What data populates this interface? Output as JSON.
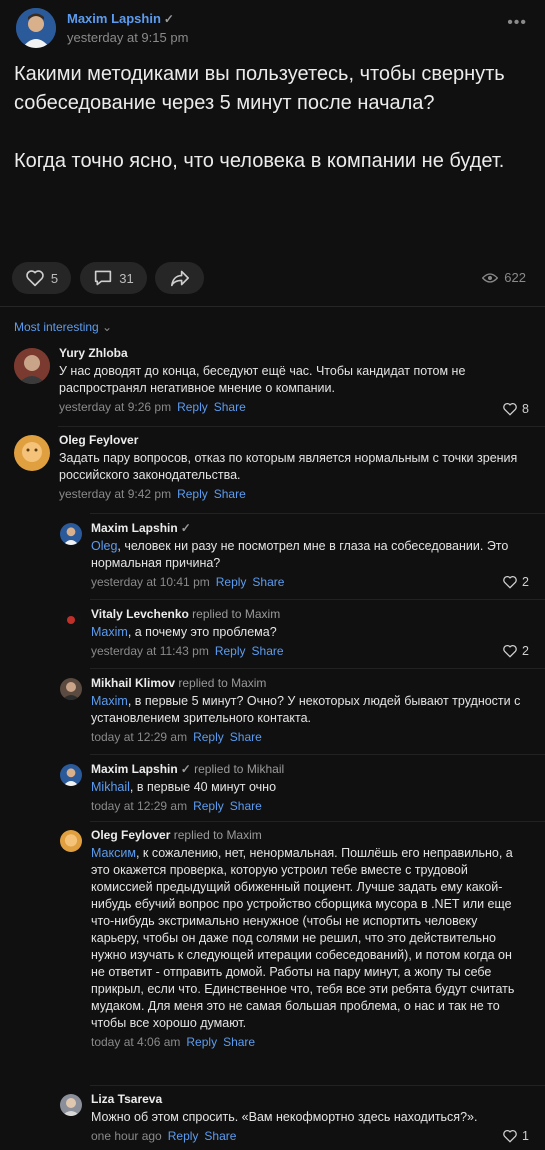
{
  "post": {
    "author": "Maxim Lapshin",
    "verified": "✓",
    "time": "yesterday at 9:15 pm",
    "more": "•••",
    "body_p1": "Какими методиками вы пользуетесь, чтобы свернуть собеседование через 5 минут после начала?",
    "body_p2": "Когда точно ясно, что человека в компании не будет.",
    "likes": "5",
    "comments": "31",
    "views": "622"
  },
  "sort_label": "Most interesting",
  "links": {
    "reply": "Reply",
    "share": "Share",
    "replied_to": "replied to"
  },
  "comments": [
    {
      "author": "Yury Zhloba",
      "text": "У нас доводят до конца, беседуют ещё час. Чтобы кандидат потом не распространял негативное мнение о компании.",
      "time": "yesterday at 9:26 pm",
      "likes": "8"
    },
    {
      "author": "Oleg Feylover",
      "text": "Задать пару вопросов, отказ по которым является нормальным с точки зрения российского законодательства.",
      "time": "yesterday at 9:42 pm",
      "likes": ""
    },
    {
      "author": "Maxim Lapshin",
      "mention": "Oleg",
      "text": ", человек ни разу не посмотрел мне в глаза на собеседовании. Это нормальная причина?",
      "time": "yesterday at 10:41 pm",
      "likes": "2"
    },
    {
      "author": "Vitaly Levchenko",
      "replied": "Maxim",
      "mention": "Maxim",
      "text": ", а почему это проблема?",
      "time": "yesterday at 11:43 pm",
      "likes": "2"
    },
    {
      "author": "Mikhail Klimov",
      "replied": "Maxim",
      "mention": "Maxim",
      "text": ", в первые 5 минут? Очно? У некоторых людей бывают трудности с установлением зрительного контакта.",
      "time": "today at 12:29 am",
      "likes": ""
    },
    {
      "author": "Maxim Lapshin",
      "replied": "Mikhail",
      "mention": "Mikhail",
      "text": ", в первые 40 минут очно",
      "time": "today at 12:29 am",
      "likes": ""
    },
    {
      "author": "Oleg Feylover",
      "replied": "Maxim",
      "mention": "Максим",
      "text": ", к сожалению, нет, ненормальная. Пошлёшь его неправильно, а это окажется проверка, которую устроил тебе вместе с трудовой комиссией предыдущий обиженный поциент. Лучше задать ему какой-нибудь ебучий вопрос про устройство сборщика мусора в .NET или еще что-нибудь экстримально ненужное (чтобы не испортить человеку карьеру, чтобы он даже под солями не решил, что это действительно нужно изучать к следующей итерации собеседований), и потом когда он не ответит - отправить домой. Работы на пару минут, а жопу ты себе прикрыл, если что. Единственное что, тебя все эти ребята будут считать мудаком. Для меня это не самая большая проблема, о нас и так не то чтобы все хорошо думают.",
      "time": "today at 4:06 am",
      "likes": ""
    },
    {
      "author": "Liza Tsareva",
      "text": "Можно об этом спросить. «Вам некофмортно здесь находиться?».",
      "time": "one hour ago",
      "likes": "1"
    }
  ],
  "colors": {
    "background": "#101010",
    "accent": "#5c9cf0",
    "muted": "#8a8a8a"
  }
}
